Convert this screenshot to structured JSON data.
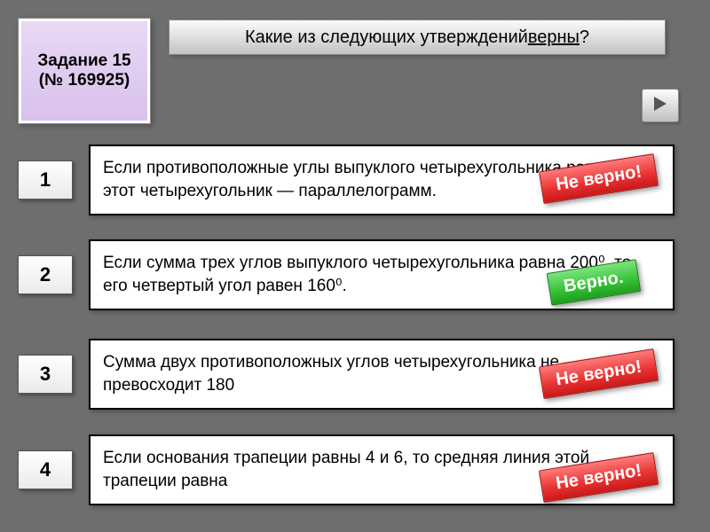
{
  "task": {
    "title_line1": "Задание 15",
    "title_line2": "(№ 169925)"
  },
  "question": {
    "prefix": "Какие из следующих утверждений ",
    "underlined": "верны",
    "suffix": "?"
  },
  "options": [
    {
      "num": "1",
      "text": "Если противоположные углы выпуклого четырехугольника равны, то этот четырехугольник — параллелограмм.",
      "stamp": "Не верно!",
      "correct": false
    },
    {
      "num": "2",
      "text_html": "Если сумма трех углов выпуклого четырехугольника равна 200⁰, то его четвертый угол равен 160⁰.",
      "stamp": "Верно.",
      "correct": true
    },
    {
      "num": "3",
      "text": "Сумма двух противоположных углов четырехугольника не превосходит 180",
      "stamp": "Не верно!",
      "correct": false
    },
    {
      "num": "4",
      "text": "Если основания трапеции равны 4 и 6, то средняя линия этой трапеции равна",
      "stamp": "Не верно!",
      "correct": false
    }
  ],
  "nav": {
    "next_label": "next"
  }
}
